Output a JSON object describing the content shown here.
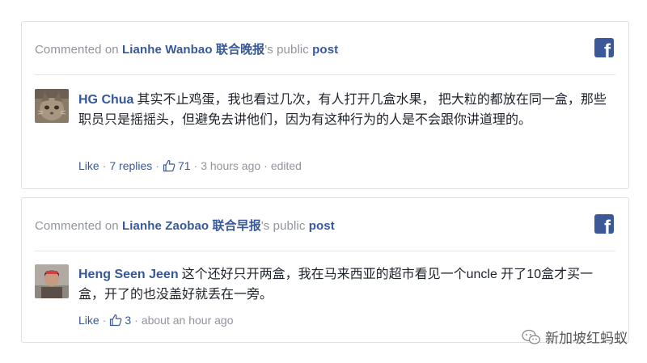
{
  "comments": [
    {
      "header": {
        "prefix": "Commented on ",
        "page": "Lianhe Wanbao 联合晚报",
        "suffix": "'s public ",
        "post": "post"
      },
      "author": "HG Chua",
      "text": "其实不止鸡蛋，我也看过几次，有人打开几盒水果， 把大粒的都放在同一盒，那些职员只是摇摇头，但避免去讲他们，因为有这种行为的人是不会跟你讲道理的。",
      "like_label": "Like",
      "replies": "7 replies",
      "like_count": "71",
      "time": "3 hours ago",
      "edited": "edited"
    },
    {
      "header": {
        "prefix": "Commented on ",
        "page": "Lianhe Zaobao 联合早报",
        "suffix": "'s public ",
        "post": "post"
      },
      "author": "Heng Seen Jeen",
      "text": "这个还好只开两盒，我在马来西亚的超市看见一个uncle 开了10盒才买一盒，开了的也没盖好就丢在一旁。",
      "like_label": "Like",
      "like_count": "3",
      "time": "about an hour ago"
    }
  ],
  "separator": "·",
  "facebook_logo_letter": "f",
  "watermark": "新加坡红蚂蚁",
  "colors": {
    "link_blue": "#365899",
    "facebook_blue": "#3b5998",
    "meta_gray": "#90949c",
    "border": "#dddfe2"
  }
}
